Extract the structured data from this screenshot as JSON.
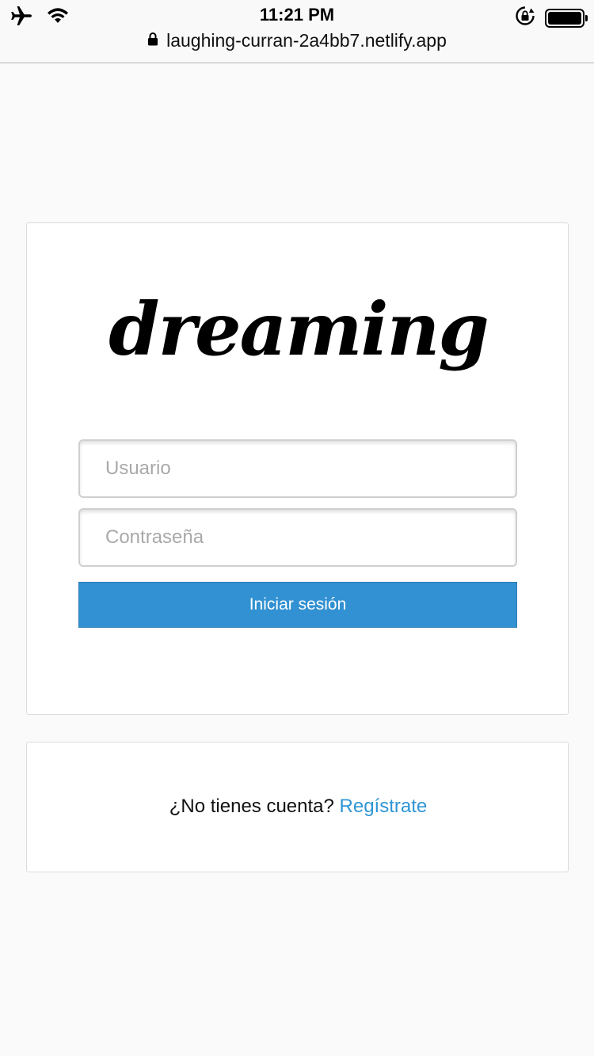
{
  "status_bar": {
    "time": "11:21 PM",
    "icons": [
      "airplane-icon",
      "wifi-icon",
      "orientation-lock-icon",
      "battery-icon"
    ]
  },
  "url_bar": {
    "url": "laughing-curran-2a4bb7.netlify.app",
    "icon": "lock-icon"
  },
  "login": {
    "logo": "dreaming",
    "username_placeholder": "Usuario",
    "username_value": "",
    "password_placeholder": "Contraseña",
    "password_value": "",
    "submit_label": "Iniciar sesión"
  },
  "signup": {
    "prompt": "¿No tienes cuenta?",
    "link_label": "Regístrate"
  },
  "colors": {
    "page_background": "#fafafa",
    "button_blue": "#3291d2",
    "link_blue": "#2f95d6"
  }
}
